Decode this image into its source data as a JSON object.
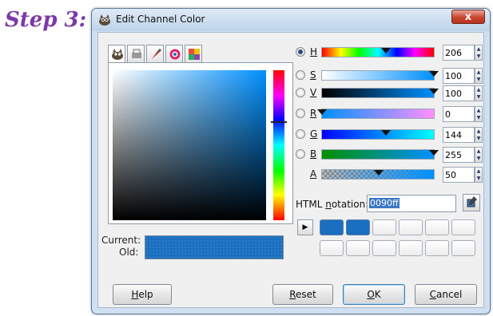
{
  "step_label": "Step 3:",
  "window": {
    "title": "Edit Channel Color",
    "close_label": "x"
  },
  "tabs": [
    {
      "name": "gimp-selector",
      "icon": "wilber-icon",
      "active": true
    },
    {
      "name": "cmyk",
      "icon": "printer-icon"
    },
    {
      "name": "watercolor",
      "icon": "brush-icon"
    },
    {
      "name": "wheel",
      "icon": "color-wheel-icon"
    },
    {
      "name": "palette",
      "icon": "palette-icon"
    }
  ],
  "swatches": {
    "current_label": "Current:",
    "old_label": "Old:",
    "current_color": "#1a6fc1"
  },
  "channels": [
    {
      "key": "H",
      "value": "206",
      "selected": true
    },
    {
      "key": "S",
      "value": "100",
      "selected": false
    },
    {
      "key": "V",
      "value": "100",
      "selected": false
    },
    {
      "key": "R",
      "value": "0",
      "selected": false
    },
    {
      "key": "G",
      "value": "144",
      "selected": false
    },
    {
      "key": "B",
      "value": "255",
      "selected": false
    },
    {
      "key": "A",
      "value": "50",
      "selected": false
    }
  ],
  "html_notation": {
    "label_prefix": "HTML ",
    "label_underlined": "n",
    "label_suffix": "otation:",
    "value": "0090ff"
  },
  "history": {
    "filled_color": "#1a6fc1",
    "filled_count": 2,
    "total": 12
  },
  "buttons": {
    "help": {
      "pre": "",
      "accel": "H",
      "post": "elp"
    },
    "reset": {
      "pre": "",
      "accel": "R",
      "post": "eset"
    },
    "ok": {
      "pre": "",
      "accel": "O",
      "post": "K"
    },
    "cancel": {
      "pre": "",
      "accel": "C",
      "post": "ancel"
    }
  }
}
